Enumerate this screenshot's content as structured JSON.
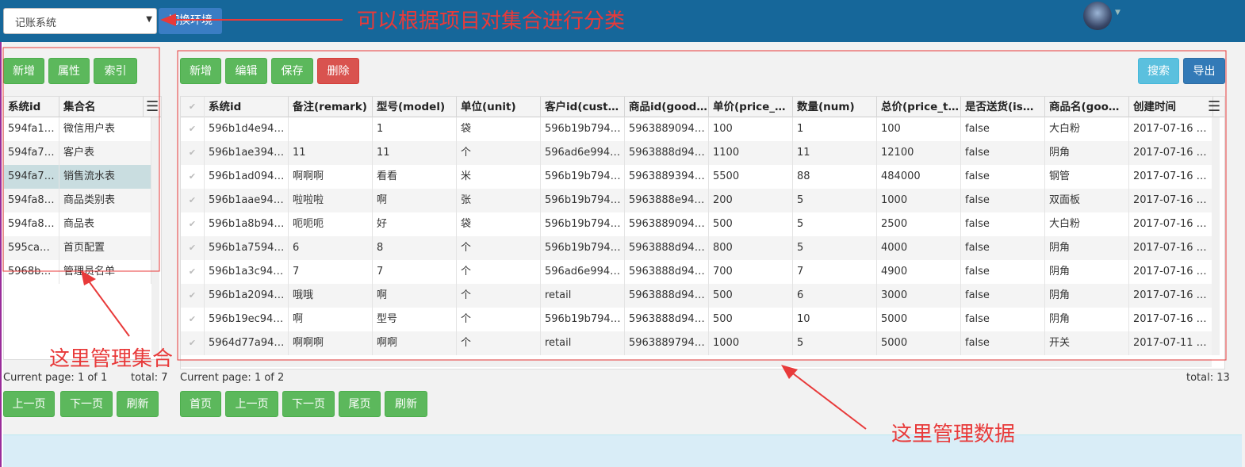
{
  "header": {
    "select_value": "记账系统",
    "switch_button": "切换环境"
  },
  "left": {
    "buttons": [
      "新增",
      "属性",
      "索引"
    ],
    "columns": [
      "系统id",
      "集合名"
    ],
    "rows": [
      [
        "594fa1…",
        "微信用户表"
      ],
      [
        "594fa7…",
        "客户表"
      ],
      [
        "594fa7…",
        "销售流水表"
      ],
      [
        "594fa8…",
        "商品类别表"
      ],
      [
        "594fa8…",
        "商品表"
      ],
      [
        "595ca…",
        "首页配置"
      ],
      [
        "5968b…",
        "管理员名单"
      ]
    ],
    "selected_row": 2,
    "footer_page": "Current page: 1 of 1",
    "footer_total": "total: 7",
    "pager_buttons": [
      "上一页",
      "下一页",
      "刷新"
    ]
  },
  "main": {
    "buttons_left": [
      "新增",
      "编辑",
      "保存",
      "删除"
    ],
    "buttons_right": [
      "搜索",
      "导出"
    ],
    "columns": [
      "系统id",
      "备注(remark)",
      "型号(model)",
      "单位(unit)",
      "客户id(cust…",
      "商品id(good…",
      "单价(price_…",
      "数量(num)",
      "总价(price_t…",
      "是否送货(is…",
      "商品名(goo…",
      "创建时间"
    ],
    "rows": [
      [
        "596b1d4e94…",
        "",
        "1",
        "袋",
        "596b19b794…",
        "5963889094…",
        "100",
        "1",
        "100",
        "false",
        "大白粉",
        "2017-07-16 …"
      ],
      [
        "596b1ae394…",
        "11",
        "11",
        "个",
        "596ad6e994…",
        "5963888d94…",
        "1100",
        "11",
        "12100",
        "false",
        "阴角",
        "2017-07-16 …"
      ],
      [
        "596b1ad094…",
        "啊啊啊",
        "看看",
        "米",
        "596b19b794…",
        "5963889394…",
        "5500",
        "88",
        "484000",
        "false",
        "钢管",
        "2017-07-16 …"
      ],
      [
        "596b1aae94…",
        "啦啦啦",
        "啊",
        "张",
        "596b19b794…",
        "5963888e94…",
        "200",
        "5",
        "1000",
        "false",
        "双面板",
        "2017-07-16 …"
      ],
      [
        "596b1a8b94…",
        "呃呃呃",
        "好",
        "袋",
        "596b19b794…",
        "5963889094…",
        "500",
        "5",
        "2500",
        "false",
        "大白粉",
        "2017-07-16 …"
      ],
      [
        "596b1a7594…",
        "6",
        "8",
        "个",
        "596b19b794…",
        "5963888d94…",
        "800",
        "5",
        "4000",
        "false",
        "阴角",
        "2017-07-16 …"
      ],
      [
        "596b1a3c94…",
        "7",
        "7",
        "个",
        "596ad6e994…",
        "5963888d94…",
        "700",
        "7",
        "4900",
        "false",
        "阴角",
        "2017-07-16 …"
      ],
      [
        "596b1a2094…",
        "哦哦",
        "啊",
        "个",
        "retail",
        "5963888d94…",
        "500",
        "6",
        "3000",
        "false",
        "阴角",
        "2017-07-16 …"
      ],
      [
        "596b19ec94…",
        "啊",
        "型号",
        "个",
        "596b19b794…",
        "5963888d94…",
        "500",
        "10",
        "5000",
        "false",
        "阴角",
        "2017-07-16 …"
      ],
      [
        "5964d77a94…",
        "啊啊啊",
        "啊啊",
        "个",
        "retail",
        "5963889794…",
        "1000",
        "5",
        "5000",
        "false",
        "开关",
        "2017-07-11 …"
      ]
    ],
    "footer_page": "Current page: 1 of 2",
    "footer_total": "total: 13",
    "pager_buttons": [
      "首页",
      "上一页",
      "下一页",
      "尾页",
      "刷新"
    ]
  },
  "annotations": {
    "top": "可以根据项目对集合进行分类",
    "left": "这里管理集合",
    "right": "这里管理数据"
  },
  "colors": {
    "header_bg": "#16679a",
    "annotation_red": "#e83a3a",
    "success_green": "#5cb85c",
    "danger_red": "#d9534f"
  }
}
